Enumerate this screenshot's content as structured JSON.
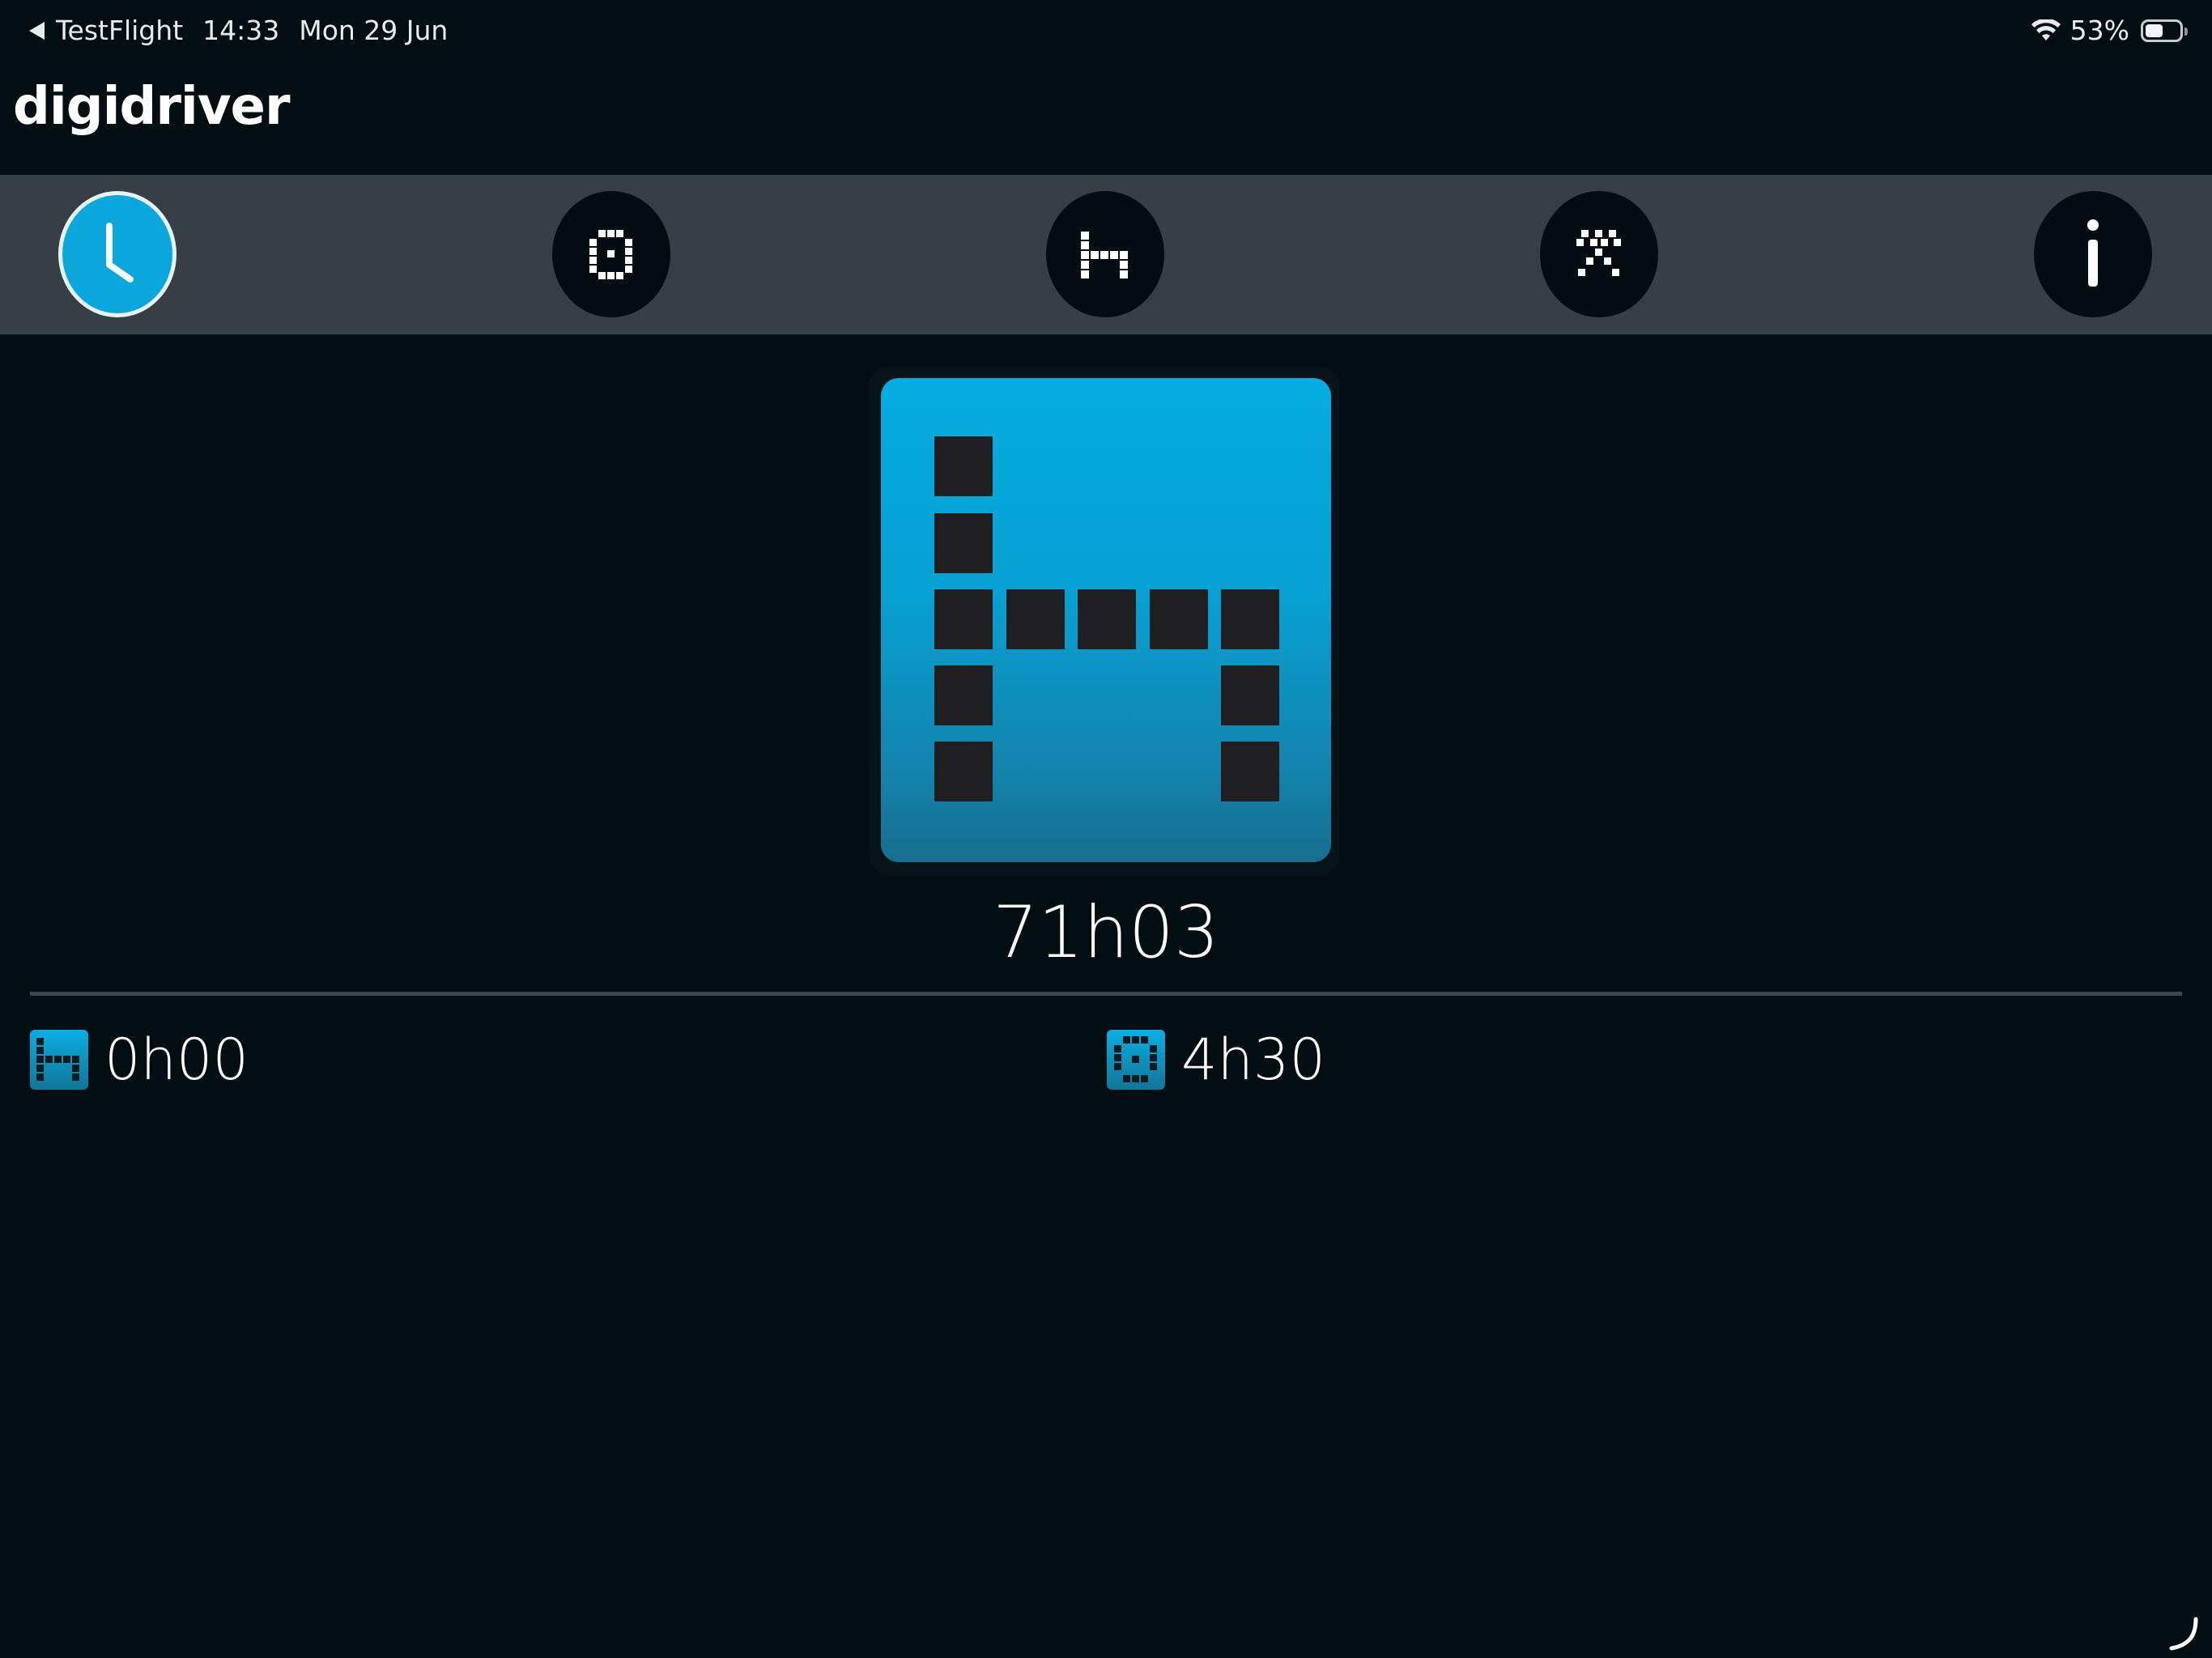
{
  "status_bar": {
    "back_app": "TestFlight",
    "time": "14:33",
    "date": "Mon 29 Jun",
    "battery_percent": "53%",
    "battery_level": 0.53
  },
  "app": {
    "logo_text": "digidriver"
  },
  "toolbar": {
    "items": [
      {
        "icon": "clock-icon",
        "active": true
      },
      {
        "icon": "available-icon",
        "active": false
      },
      {
        "icon": "rest-bed-icon",
        "active": false
      },
      {
        "icon": "work-hammers-icon",
        "active": false
      },
      {
        "icon": "info-icon",
        "active": false
      }
    ]
  },
  "main": {
    "card_icon": "rest-bed-icon",
    "total_time": "71h03",
    "stats": [
      {
        "icon": "rest-bed-icon",
        "value": "0h00"
      },
      {
        "icon": "available-icon",
        "value": "4h30"
      }
    ]
  },
  "colors": {
    "background": "#030e13",
    "toolbar": "#353f44",
    "accent": "#0aa7dd",
    "card_top": "#05ade0",
    "card_bottom": "#176e8e"
  }
}
